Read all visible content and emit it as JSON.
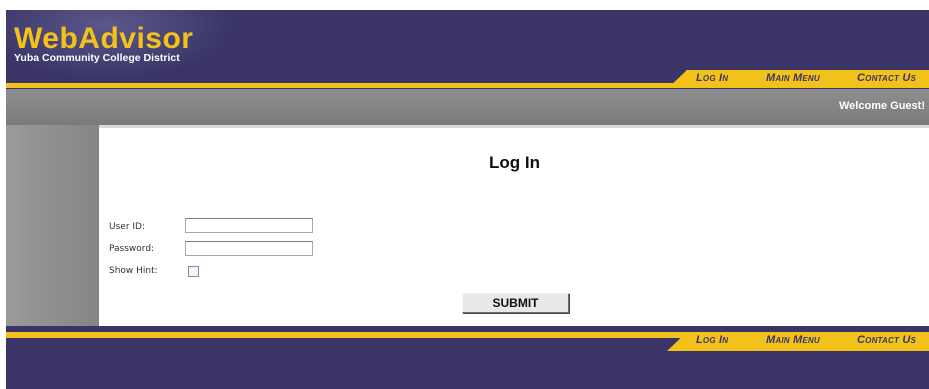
{
  "logo": {
    "title": "WebAdvisor",
    "subtitle": "Yuba Community College District"
  },
  "nav": {
    "login": "Log In",
    "main_menu": "Main Menu",
    "contact_us": "Contact Us"
  },
  "welcome": "Welcome Guest!",
  "page_title": "Log In",
  "form": {
    "user_id_label": "User ID:",
    "user_id_value": "",
    "password_label": "Password:",
    "password_value": "",
    "show_hint_label": "Show Hint:",
    "show_hint_checked": false,
    "submit_label": "SUBMIT"
  },
  "colors": {
    "brand_purple": "#3a3566",
    "brand_yellow": "#f2c21a",
    "gray_bar": "#858585"
  }
}
